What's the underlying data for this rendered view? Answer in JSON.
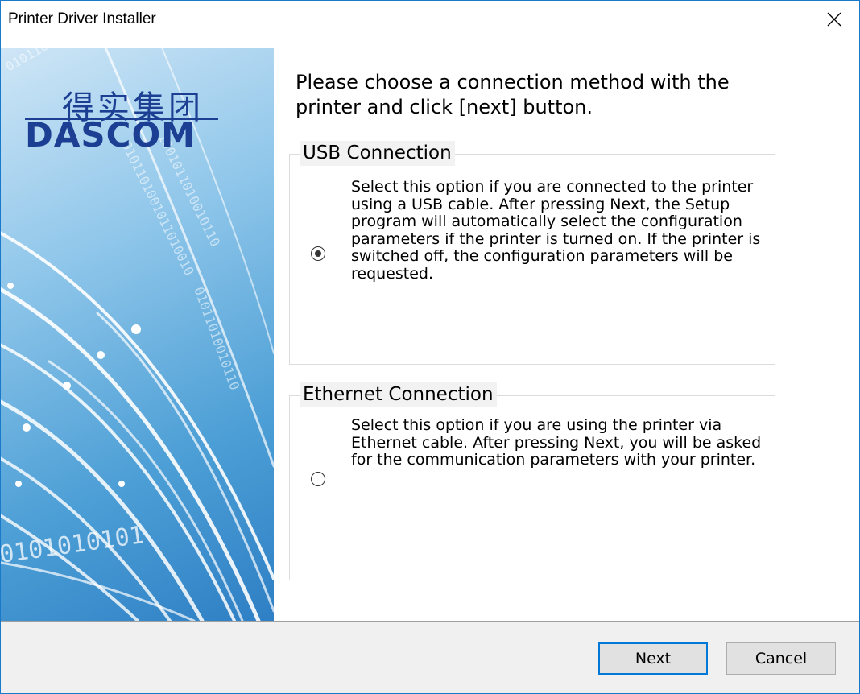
{
  "window": {
    "title": "Printer Driver Installer"
  },
  "banner": {
    "logo_cn": "得实集团",
    "logo_en": "DASCOM",
    "binary_text": "0101010101"
  },
  "main": {
    "instruction": "Please choose a connection method with the printer and click [next] button.",
    "options": [
      {
        "legend": "USB Connection",
        "description": "Select this option if you are connected to the printer using a USB cable. After pressing Next, the Setup program will automatically select the configuration parameters if the printer is turned on. If the printer is switched off, the configuration parameters will be requested.",
        "selected": true
      },
      {
        "legend": "Ethernet Connection",
        "description": "Select this option if you are using the printer via Ethernet cable. After pressing Next, you will be asked for the communication parameters with your printer.",
        "selected": false
      }
    ]
  },
  "footer": {
    "next_label": "Next",
    "cancel_label": "Cancel"
  },
  "colors": {
    "accent": "#0078d7",
    "window_border": "#1979ca",
    "logo": "#1c3f93"
  }
}
